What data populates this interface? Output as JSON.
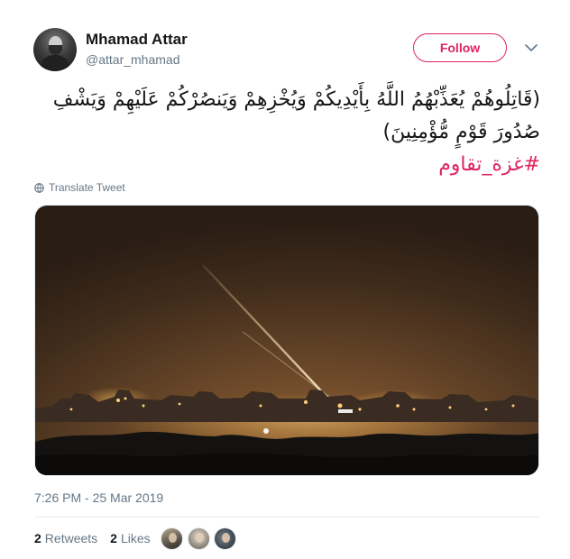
{
  "user": {
    "name": "Mhamad Attar",
    "handle": "@attar_mhamad",
    "avatar": "avatar-photo"
  },
  "header": {
    "follow_label": "Follow",
    "accent_color": "#e0245e",
    "menu_icon": "chevron-down-icon"
  },
  "tweet": {
    "text": "(قَاتِلُوهُمْ يُعَذِّبْهُمُ اللَّهُ بِأَيْدِيكُمْ وَيُخْزِهِمْ وَيَنصُرْكُمْ عَلَيْهِمْ وَيَشْفِ صُدُورَ قَوْمٍ مُّؤْمِنِينَ)",
    "hashtag": "#غزة_تقاوم",
    "translate_label": "Translate Tweet",
    "translate_icon": "globe-icon"
  },
  "media": {
    "type": "photo",
    "icon": "photo-night-rocket-launch"
  },
  "meta": {
    "timestamp": "7:26 PM - 25 Mar 2019"
  },
  "stats": {
    "retweets_count": "2",
    "retweets_label": "Retweets",
    "likes_count": "2",
    "likes_label": "Likes"
  },
  "likers": [
    "liker-avatar-1",
    "liker-avatar-2",
    "liker-avatar-3"
  ]
}
